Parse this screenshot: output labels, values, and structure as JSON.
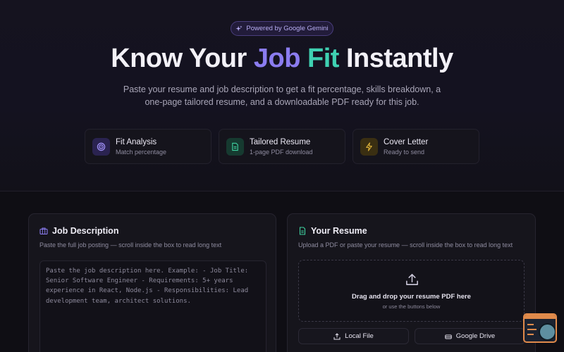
{
  "hero": {
    "badge": "Powered by Google Gemini",
    "title_part1": "Know Your ",
    "title_job": "Job",
    "title_fit": " Fit",
    "title_part2": " Instantly",
    "subtitle_line1": "Paste your resume and job description to get a fit percentage, skills breakdown, a",
    "subtitle_line2": "one-page tailored resume, and a downloadable PDF ready for this job."
  },
  "features": [
    {
      "title": "Fit Analysis",
      "subtitle": "Match percentage",
      "icon": "target-icon",
      "color": "#8b7cf0"
    },
    {
      "title": "Tailored Resume",
      "subtitle": "1-page PDF download",
      "icon": "document-icon",
      "color": "#3fd1a0"
    },
    {
      "title": "Cover Letter",
      "subtitle": "Ready to send",
      "icon": "lightning-icon",
      "color": "#e0b43a"
    }
  ],
  "job_panel": {
    "title": "Job Description",
    "subtitle": "Paste the full job posting — scroll inside the box to read long text",
    "placeholder": "Paste the job description here.  Example: - Job Title: Senior Software Engineer - Requirements: 5+ years experience in React, Node.js - Responsibilities: Lead development team, architect solutions."
  },
  "resume_panel": {
    "title": "Your Resume",
    "subtitle": "Upload a PDF or paste your resume — scroll inside the box to read long text",
    "drop_title": "Drag and drop your resume PDF here",
    "drop_subtitle": "or use the buttons below",
    "local_button": "Local File",
    "drive_button": "Google Drive"
  },
  "colors": {
    "accent_purple": "#8b7cf0",
    "accent_teal": "#3fd1b2",
    "background": "#0f0e14"
  }
}
